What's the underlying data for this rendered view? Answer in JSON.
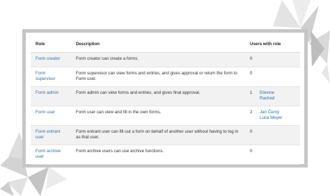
{
  "table": {
    "headers": {
      "role": "Role",
      "description": "Description",
      "users": "Users with role"
    },
    "rows": [
      {
        "role": "Form creator",
        "description": "Form creator can create a forms.",
        "count": "0",
        "users": []
      },
      {
        "role": "Form supervisor",
        "description": "Form supervisor can view forms and entries, and gives approval or return the form to Form user.",
        "count": "0",
        "users": []
      },
      {
        "role": "Form admin",
        "description": "Form admin can view forms and entries, and gives final approval.",
        "count": "1",
        "users": [
          "Etienne",
          "Rached"
        ]
      },
      {
        "role": "Form user",
        "description": "Form user can view and fill in the own forms.",
        "count": "2",
        "users": [
          "Jan Černý",
          "Luca Meyer"
        ]
      },
      {
        "role": "Form entrant user",
        "description": "Form entrant user can fill out a form on behalf of another user without having to log in as that user.",
        "count": "0",
        "users": []
      },
      {
        "role": "Form archive user",
        "description": "Form archive users can use archive functions.",
        "count": "0",
        "users": []
      }
    ]
  }
}
